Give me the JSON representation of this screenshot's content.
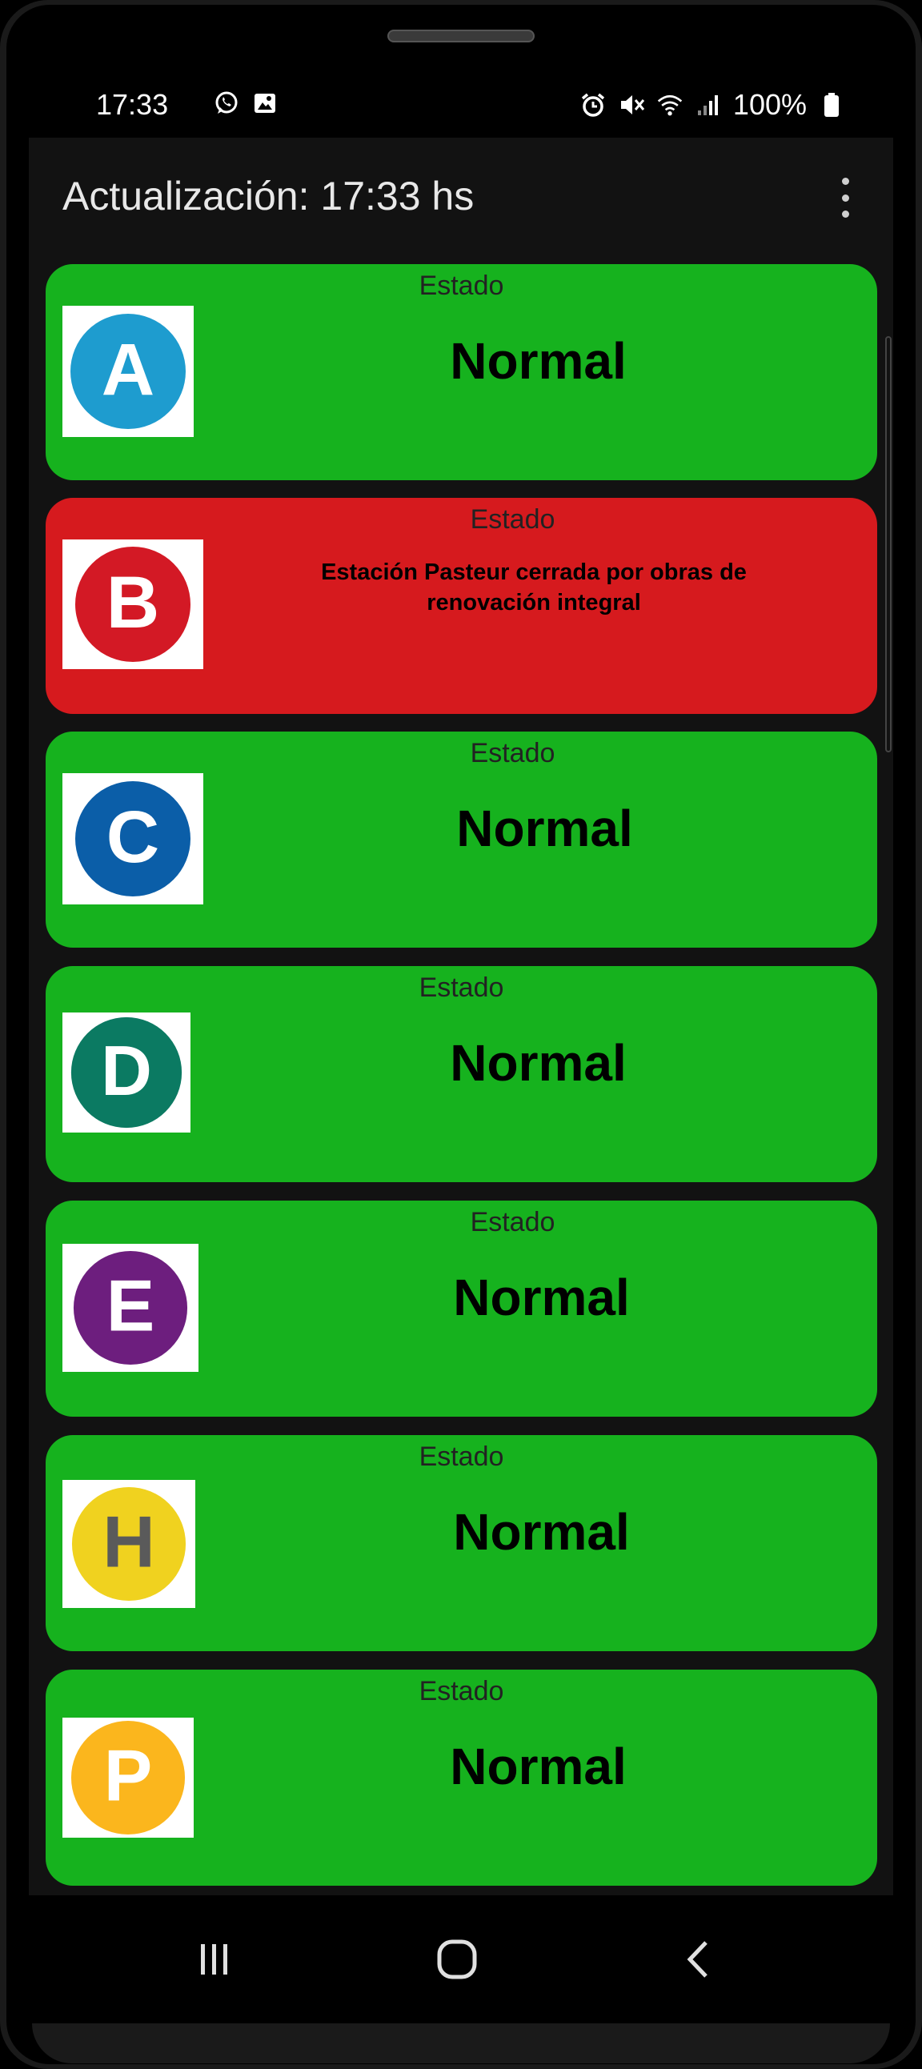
{
  "status_bar": {
    "time": "17:33",
    "battery": "100%",
    "left_icons": [
      "whatsapp-icon",
      "image-icon"
    ],
    "right_icons": [
      "alarm-icon",
      "mute-icon",
      "wifi-icon",
      "signal-icon",
      "battery-icon"
    ]
  },
  "toolbar": {
    "title": "Actualización: 17:33 hs",
    "menu_icon": "more-vert-icon"
  },
  "lines": [
    {
      "letter": "A",
      "logo_color": "#1e9ccf",
      "letter_color": "#ffffff",
      "status_label": "Estado",
      "status": "Normal",
      "state": "ok"
    },
    {
      "letter": "B",
      "logo_color": "#d31925",
      "letter_color": "#ffffff",
      "status_label": "Estado",
      "status": "Estación Pasteur cerrada por obras de renovación integral",
      "state": "alert"
    },
    {
      "letter": "C",
      "logo_color": "#0b5ea8",
      "letter_color": "#ffffff",
      "status_label": "Estado",
      "status": "Normal",
      "state": "ok"
    },
    {
      "letter": "D",
      "logo_color": "#0b7a62",
      "letter_color": "#ffffff",
      "status_label": "Estado",
      "status": "Normal",
      "state": "ok"
    },
    {
      "letter": "E",
      "logo_color": "#6d1e7e",
      "letter_color": "#ffffff",
      "status_label": "Estado",
      "status": "Normal",
      "state": "ok"
    },
    {
      "letter": "H",
      "logo_color": "#f0d21f",
      "letter_color": "#5a5a5a",
      "status_label": "Estado",
      "status": "Normal",
      "state": "ok"
    },
    {
      "letter": "P",
      "logo_color": "#fbb61d",
      "letter_color": "#ffffff",
      "status_label": "Estado",
      "status": "Normal",
      "state": "ok"
    }
  ],
  "colors": {
    "card_ok": "#16b21e",
    "card_alert": "#d61a1e",
    "background": "#121212"
  },
  "navbar": {
    "buttons": [
      "recent-apps-icon",
      "home-icon",
      "back-icon"
    ]
  }
}
